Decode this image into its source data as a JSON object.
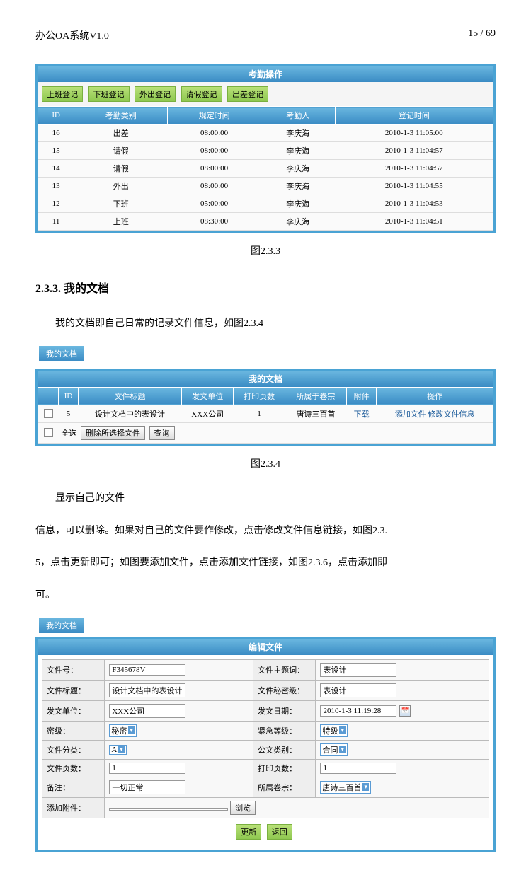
{
  "header": {
    "title": "办公OA系统V1.0",
    "page": "15 / 69"
  },
  "panel1": {
    "title": "考勤操作",
    "buttons": [
      "上班登记",
      "下班登记",
      "外出登记",
      "请假登记",
      "出差登记"
    ],
    "cols": [
      "ID",
      "考勤类别",
      "规定时间",
      "考勤人",
      "登记时间"
    ],
    "rows": [
      [
        "16",
        "出差",
        "08:00:00",
        "李庆海",
        "2010-1-3 11:05:00"
      ],
      [
        "15",
        "请假",
        "08:00:00",
        "李庆海",
        "2010-1-3 11:04:57"
      ],
      [
        "14",
        "请假",
        "08:00:00",
        "李庆海",
        "2010-1-3 11:04:57"
      ],
      [
        "13",
        "外出",
        "08:00:00",
        "李庆海",
        "2010-1-3 11:04:55"
      ],
      [
        "12",
        "下班",
        "05:00:00",
        "李庆海",
        "2010-1-3 11:04:53"
      ],
      [
        "11",
        "上班",
        "08:30:00",
        "李庆海",
        "2010-1-3 11:04:51"
      ]
    ]
  },
  "cap1": "图2.3.3",
  "heading": "2.3.3. 我的文档",
  "para1": "我的文档即自己日常的记录文件信息，如图2.3.4",
  "tab1": "我的文档",
  "panel2": {
    "title": "我的文档",
    "cols": [
      "",
      "ID",
      "文件标题",
      "发文单位",
      "打印页数",
      "所属于卷宗",
      "附件",
      "操作"
    ],
    "row": [
      "",
      "5",
      "设计文档中的表设计",
      "XXX公司",
      "1",
      "唐诗三百首",
      "下载",
      "添加文件  修改文件信息"
    ],
    "footer": {
      "all": "全选",
      "del": "删除所选择文件",
      "query": "查询"
    }
  },
  "cap2": "图2.3.4",
  "para2a": "显示自己的文件",
  "para2b": "信息，可以删除。如果对自己的文件要作修改，点击修改文件信息链接，如图2.3.",
  "para2c": "5，点击更新即可；如图要添加文件，点击添加文件链接，如图2.3.6，点击添加即",
  "para2d": "可。",
  "tab2": "我的文档",
  "panel3": {
    "title": "编辑文件",
    "fields": {
      "fileno_l": "文件号：",
      "fileno_v": "F345678V",
      "subject_l": "文件主题词：",
      "subject_v": "表设计",
      "title_l": "文件标题：",
      "title_v": "设计文档中的表设计",
      "secret_l": "文件秘密级：",
      "secret_v": "表设计",
      "unit_l": "发文单位：",
      "unit_v": "XXX公司",
      "date_l": "发文日期：",
      "date_v": "2010-1-3 11:19:28",
      "seclvl_l": "密级：",
      "seclvl_v": "秘密",
      "urgent_l": "紧急等级：",
      "urgent_v": "特级",
      "category_l": "文件分类：",
      "category_v": "A",
      "doctype_l": "公文类别：",
      "doctype_v": "合同",
      "pages_l": "文件页数：",
      "pages_v": "1",
      "printpg_l": "打印页数：",
      "printpg_v": "1",
      "note_l": "备注：",
      "note_v": "一切正常",
      "folder_l": "所属卷宗：",
      "folder_v": "唐诗三百首",
      "attach_l": "添加附件：",
      "browse": "浏览"
    },
    "btns": {
      "update": "更新",
      "back": "返回"
    }
  }
}
